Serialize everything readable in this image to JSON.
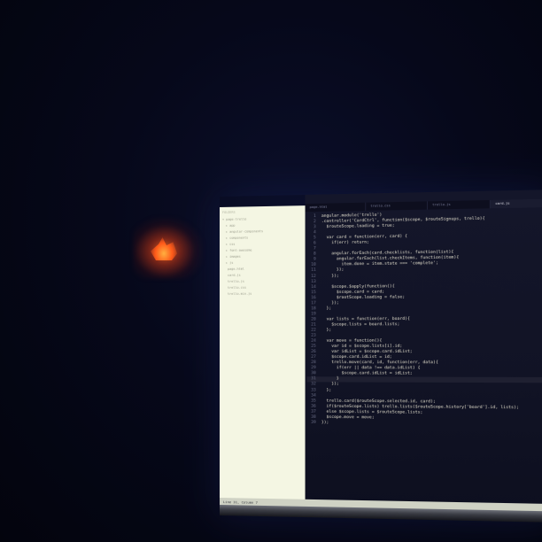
{
  "editor": {
    "tabs": [
      {
        "label": "page.html",
        "active": false
      },
      {
        "label": "trello.css",
        "active": false
      },
      {
        "label": "trello.js",
        "active": false
      },
      {
        "label": "card.js",
        "active": true
      }
    ],
    "status": "Line 31, Column 7",
    "sidebar_header": "FOLDERS",
    "sidebar_items": [
      "▾ page-trello",
      "▸ app",
      "▸ angular-components",
      "▸ components",
      "▸ css",
      "▸ font-awesome",
      "▸ images",
      "▸ js",
      "page.html",
      "card.js",
      "trello.js",
      "trello.css",
      "trello.min.js"
    ],
    "code_lines": [
      "angular.module('trello')",
      ".controller('CardCtrl', function($scope, $routeSignups, trello){",
      "  $routeScope.loading = true;",
      "",
      "  var card = function(err, card) {",
      "    if(err) return;",
      "",
      "    angular.forEach(card.checklists, function(list){",
      "      angular.forEach(list.checkItems, function(item){",
      "        item.done = item.state === 'complete';",
      "      });",
      "    });",
      "",
      "    $scope.$apply(function(){",
      "      $scope.card = card;",
      "      $rootScope.loading = false;",
      "    });",
      "  };",
      "",
      "  var lists = function(err, board){",
      "    $scope.lists = board.lists;",
      "  };",
      "",
      "  var move = function(){",
      "    var id = $scope.lists[i].id;",
      "    var idList = $scope.card.idList;",
      "    $scope.card.idList = id;",
      "    trello.move(card, id, function(err, data){",
      "      if(err || data !== data.idList) {",
      "        $scope.card.idList = idList;",
      "      }",
      "    });",
      "  };",
      "",
      "  trello.card($routeScope.selected.id, card);",
      "  if($routeScope.lists) trello.lists($routeScope.history['board'].id, lists);",
      "  else $scope.lists = $routeScope.lists;",
      "  $scope.move = move;",
      "});"
    ],
    "current_line": 31
  }
}
